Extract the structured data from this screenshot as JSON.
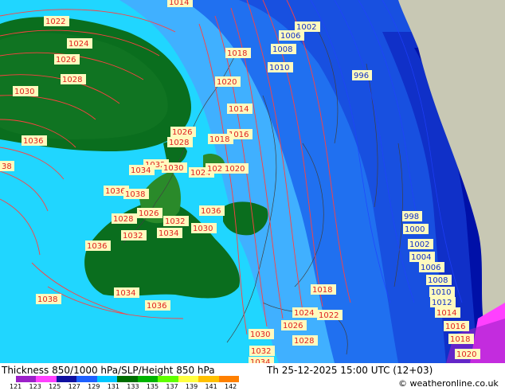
{
  "title": "Thickness 850/1000 hPa/SLP/Height 850 hPa",
  "datetime": "Th 25-12-2025 15:00 UTC (12+03)",
  "copyright": "© weatheronline.co.uk",
  "scale": {
    "ticks": [
      "121",
      "123",
      "125",
      "127",
      "129",
      "131",
      "133",
      "135",
      "137",
      "139",
      "141",
      "142"
    ],
    "colors": [
      "#9b20c8",
      "#ff40ff",
      "#1010a0",
      "#1e60ff",
      "#00c8ff",
      "#006e00",
      "#00b400",
      "#60ff00",
      "#ffff40",
      "#ffc000",
      "#ff8000"
    ]
  },
  "colors": {
    "land_green_dark": "#0a6e1e",
    "land_green": "#2a8a2a",
    "band_cyan": "#20d6ff",
    "band_lightblue": "#40b0ff",
    "band_blue": "#2070f0",
    "band_darkblue": "#1030c8",
    "band_navy": "#0010a8",
    "grey_land": "#c8c8b4",
    "isobar_red": "#ff4040",
    "label_bg": "#fffabe"
  },
  "labels": [
    {
      "text": "1014",
      "color": "red"
    },
    {
      "text": "1022",
      "color": "red"
    },
    {
      "text": "1024",
      "color": "red"
    },
    {
      "text": "1026",
      "color": "red"
    },
    {
      "text": "1028",
      "color": "red"
    },
    {
      "text": "1030",
      "color": "red"
    },
    {
      "text": "1036",
      "color": "red"
    },
    {
      "text": "38",
      "color": "red"
    },
    {
      "text": "1002",
      "color": "blue"
    },
    {
      "text": "1006",
      "color": "blue"
    },
    {
      "text": "1008",
      "color": "blue"
    },
    {
      "text": "1010",
      "color": "blue"
    },
    {
      "text": "996",
      "color": "blue"
    },
    {
      "text": "1018",
      "color": "red"
    },
    {
      "text": "1020",
      "color": "red"
    },
    {
      "text": "1014",
      "color": "red"
    },
    {
      "text": "1016",
      "color": "red"
    },
    {
      "text": "1018",
      "color": "red"
    },
    {
      "text": "1026",
      "color": "red"
    },
    {
      "text": "1028",
      "color": "red"
    },
    {
      "text": "1032",
      "color": "red"
    },
    {
      "text": "1030",
      "color": "red"
    },
    {
      "text": "1034",
      "color": "red"
    },
    {
      "text": "1024",
      "color": "red"
    },
    {
      "text": "1022",
      "color": "red"
    },
    {
      "text": "1020",
      "color": "red"
    },
    {
      "text": "1036",
      "color": "red"
    },
    {
      "text": "1038",
      "color": "red"
    },
    {
      "text": "1036",
      "color": "red"
    },
    {
      "text": "1026",
      "color": "red"
    },
    {
      "text": "1032",
      "color": "red"
    },
    {
      "text": "1030",
      "color": "red"
    },
    {
      "text": "1028",
      "color": "red"
    },
    {
      "text": "1034",
      "color": "red"
    },
    {
      "text": "1032",
      "color": "red"
    },
    {
      "text": "1036",
      "color": "red"
    },
    {
      "text": "1038",
      "color": "red"
    },
    {
      "text": "1034",
      "color": "red"
    },
    {
      "text": "1036",
      "color": "red"
    },
    {
      "text": "1018",
      "color": "red"
    },
    {
      "text": "1024",
      "color": "red"
    },
    {
      "text": "1022",
      "color": "red"
    },
    {
      "text": "1026",
      "color": "red"
    },
    {
      "text": "1030",
      "color": "red"
    },
    {
      "text": "1028",
      "color": "red"
    },
    {
      "text": "1032",
      "color": "red"
    },
    {
      "text": "1034",
      "color": "red"
    },
    {
      "text": "998",
      "color": "blue"
    },
    {
      "text": "1000",
      "color": "blue"
    },
    {
      "text": "1002",
      "color": "blue"
    },
    {
      "text": "1004",
      "color": "blue"
    },
    {
      "text": "1006",
      "color": "blue"
    },
    {
      "text": "1008",
      "color": "blue"
    },
    {
      "text": "1010",
      "color": "blue"
    },
    {
      "text": "1012",
      "color": "blue"
    },
    {
      "text": "1014",
      "color": "red"
    },
    {
      "text": "1016",
      "color": "red"
    },
    {
      "text": "1018",
      "color": "red"
    },
    {
      "text": "1020",
      "color": "red"
    }
  ]
}
